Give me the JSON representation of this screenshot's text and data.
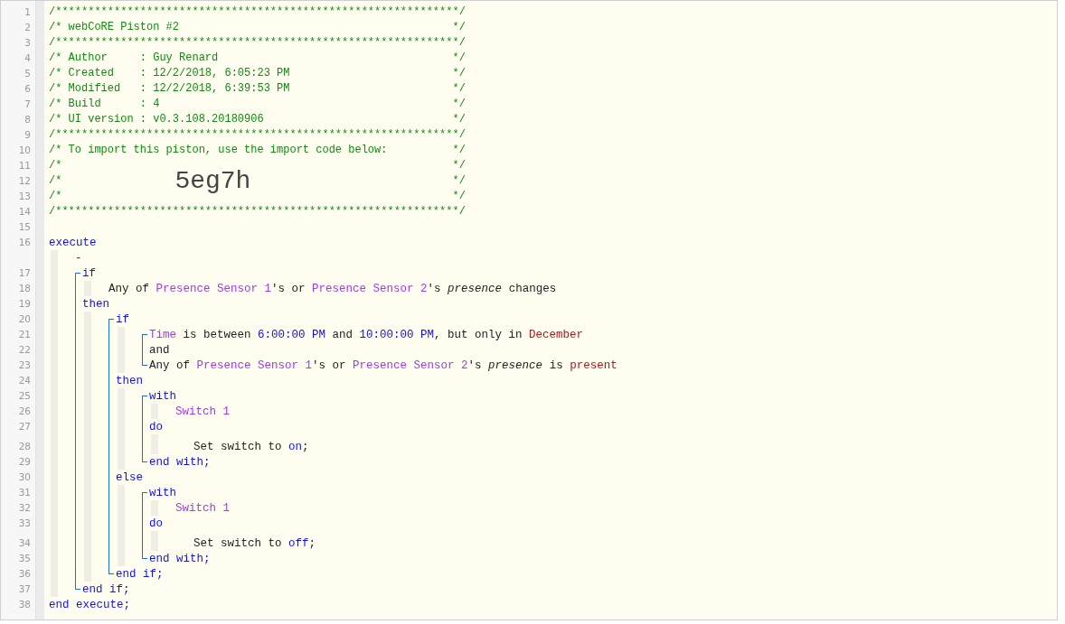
{
  "header_lines": [
    {
      "num": "1",
      "text": "/**************************************************************/"
    },
    {
      "num": "2",
      "text": "/* webCoRE Piston #2",
      "end": "*/"
    },
    {
      "num": "3",
      "text": "/**************************************************************/"
    },
    {
      "num": "4",
      "text": "/* Author     : Guy Renard",
      "end": "*/"
    },
    {
      "num": "5",
      "text": "/* Created    : 12/2/2018, 6:05:23 PM",
      "end": "*/"
    },
    {
      "num": "6",
      "text": "/* Modified   : 12/2/2018, 6:39:53 PM",
      "end": "*/"
    },
    {
      "num": "7",
      "text": "/* Build      : 4",
      "end": "*/"
    },
    {
      "num": "8",
      "text": "/* UI version : v0.3.108.20180906",
      "end": "*/"
    },
    {
      "num": "9",
      "text": "/**************************************************************/"
    },
    {
      "num": "10",
      "text": "/* To import this piston, use the import code below:",
      "end": "*/"
    },
    {
      "num": "11",
      "text": "/*",
      "end": "*/"
    },
    {
      "num": "12",
      "text": "/*",
      "code": "5eg7h",
      "end": "*/"
    },
    {
      "num": "13",
      "text": "/*",
      "end": "*/"
    },
    {
      "num": "14",
      "text": "/**************************************************************/"
    }
  ],
  "body": [
    {
      "num": "15"
    },
    {
      "num": "16",
      "segments": [
        {
          "kind": "keyword",
          "text": "execute"
        }
      ],
      "children": [
        {
          "segments": [
            {
              "kind": "keyword",
              "text": "-"
            }
          ]
        },
        {
          "kind": "statement",
          "lines": [
            {
              "num": "17",
              "segments": [
                {
                  "kind": "keyword",
                  "text": "if"
                }
              ],
              "children": [
                {
                  "num": "18",
                  "segments": [
                    {
                      "kind": "text",
                      "text": "Any of "
                    },
                    {
                      "kind": "device",
                      "text": "Presence Sensor 1"
                    },
                    {
                      "kind": "text",
                      "text": "'s or "
                    },
                    {
                      "kind": "device",
                      "text": "Presence Sensor 2"
                    },
                    {
                      "kind": "text",
                      "text": "'s "
                    },
                    {
                      "kind": "attribute",
                      "text": "presence"
                    },
                    {
                      "kind": "text",
                      "text": " changes"
                    }
                  ]
                }
              ]
            },
            {
              "num": "19",
              "segments": [
                {
                  "kind": "keyword",
                  "text": "then"
                }
              ],
              "children": [
                {
                  "kind": "statement",
                  "lines": [
                    {
                      "num": "20",
                      "segments": [
                        {
                          "kind": "keyword",
                          "text": "if"
                        }
                      ],
                      "children": [
                        {
                          "kind": "statement",
                          "lines": [
                            {
                              "num": "21",
                              "segments": [
                                {
                                  "kind": "device",
                                  "text": "Time"
                                },
                                {
                                  "kind": "text",
                                  "text": " is between "
                                },
                                {
                                  "kind": "value",
                                  "text": "6:00:00 PM"
                                },
                                {
                                  "kind": "text",
                                  "text": " and "
                                },
                                {
                                  "kind": "value",
                                  "text": "10:00:00 PM"
                                },
                                {
                                  "kind": "text",
                                  "text": ", but only in "
                                },
                                {
                                  "kind": "literal",
                                  "text": "December"
                                }
                              ]
                            },
                            {
                              "num": "22",
                              "segments": [
                                {
                                  "kind": "text",
                                  "text": "and"
                                }
                              ]
                            },
                            {
                              "num": "23",
                              "segments": [
                                {
                                  "kind": "text",
                                  "text": "Any of "
                                },
                                {
                                  "kind": "device",
                                  "text": "Presence Sensor 1"
                                },
                                {
                                  "kind": "text",
                                  "text": "'s or "
                                },
                                {
                                  "kind": "device",
                                  "text": "Presence Sensor 2"
                                },
                                {
                                  "kind": "text",
                                  "text": "'s "
                                },
                                {
                                  "kind": "attribute",
                                  "text": "presence"
                                },
                                {
                                  "kind": "text",
                                  "text": " is "
                                },
                                {
                                  "kind": "literal",
                                  "text": "present"
                                }
                              ]
                            }
                          ]
                        }
                      ]
                    },
                    {
                      "num": "24",
                      "segments": [
                        {
                          "kind": "keyword",
                          "text": "then"
                        }
                      ],
                      "children": [
                        {
                          "kind": "statement",
                          "lines": [
                            {
                              "num": "25",
                              "segments": [
                                {
                                  "kind": "keyword",
                                  "text": "with"
                                }
                              ],
                              "children": [
                                {
                                  "num": "26",
                                  "segments": [
                                    {
                                      "kind": "device",
                                      "text": "Switch 1"
                                    }
                                  ]
                                }
                              ]
                            },
                            {
                              "num": "27",
                              "segments": [
                                {
                                  "kind": "keyword",
                                  "text": "do"
                                }
                              ],
                              "children": [
                                {
                                  "num": "28",
                                  "kind": "task",
                                  "segments": [
                                    {
                                      "kind": "text",
                                      "text": "Set switch to "
                                    },
                                    {
                                      "kind": "value",
                                      "text": "on"
                                    },
                                    {
                                      "kind": "text",
                                      "text": ";"
                                    }
                                  ]
                                }
                              ]
                            },
                            {
                              "num": "29",
                              "segments": [
                                {
                                  "kind": "keyword",
                                  "text": "end with;"
                                }
                              ]
                            }
                          ]
                        }
                      ]
                    },
                    {
                      "num": "30",
                      "segments": [
                        {
                          "kind": "keyword",
                          "text": "else"
                        }
                      ],
                      "children": [
                        {
                          "kind": "statement",
                          "lines": [
                            {
                              "num": "31",
                              "segments": [
                                {
                                  "kind": "keyword",
                                  "text": "with"
                                }
                              ],
                              "children": [
                                {
                                  "num": "32",
                                  "segments": [
                                    {
                                      "kind": "device",
                                      "text": "Switch 1"
                                    }
                                  ]
                                }
                              ]
                            },
                            {
                              "num": "33",
                              "segments": [
                                {
                                  "kind": "keyword",
                                  "text": "do"
                                }
                              ],
                              "children": [
                                {
                                  "num": "34",
                                  "kind": "task",
                                  "segments": [
                                    {
                                      "kind": "text",
                                      "text": "Set switch to "
                                    },
                                    {
                                      "kind": "value",
                                      "text": "off"
                                    },
                                    {
                                      "kind": "text",
                                      "text": ";"
                                    }
                                  ]
                                }
                              ]
                            },
                            {
                              "num": "35",
                              "segments": [
                                {
                                  "kind": "keyword",
                                  "text": "end with;"
                                }
                              ]
                            }
                          ]
                        }
                      ]
                    },
                    {
                      "num": "36",
                      "segments": [
                        {
                          "kind": "keyword",
                          "text": "end if;"
                        }
                      ]
                    }
                  ]
                }
              ]
            },
            {
              "num": "37",
              "segments": [
                {
                  "kind": "keyword",
                  "text": "end if;"
                }
              ]
            }
          ]
        }
      ]
    },
    {
      "num": "38",
      "segments": [
        {
          "kind": "keyword",
          "text": "end execute;"
        }
      ]
    }
  ]
}
